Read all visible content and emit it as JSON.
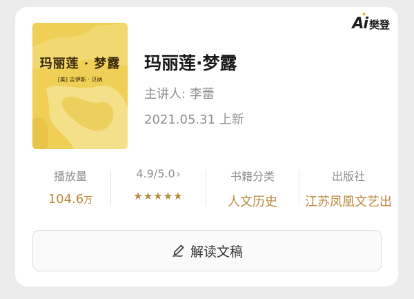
{
  "brand": {
    "ai": "Ai",
    "name": "樊登"
  },
  "book": {
    "cover_title": "玛丽莲 · 梦露",
    "cover_author": "[美] 吉伊斯 · 贝纳",
    "title": "玛丽莲·梦露",
    "lecturer": "主讲人: 李蕾",
    "date": "2021.05.31 上新"
  },
  "stats": {
    "plays": {
      "label": "播放量",
      "value": "104.6",
      "unit": "万"
    },
    "rating": {
      "label": "4.9/5.0",
      "stars": "★★★★★",
      "chevron": "›"
    },
    "category": {
      "label": "书籍分类",
      "value": "人文历史"
    },
    "publisher": {
      "label": "出版社",
      "value": "江苏凤凰文艺出"
    }
  },
  "action": {
    "label": "解读文稿",
    "icon": "manuscript-pen-icon"
  },
  "colors": {
    "accent": "#b8893c",
    "cover": "#efcf55"
  }
}
